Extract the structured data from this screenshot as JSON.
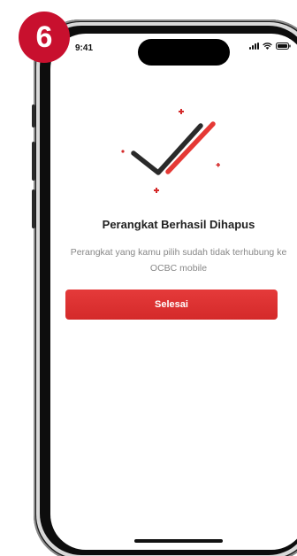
{
  "step": {
    "number": "6"
  },
  "status_bar": {
    "time": "9:41",
    "icons": [
      "signal-icon",
      "wifi-icon",
      "battery-icon"
    ]
  },
  "screen": {
    "title": "Perangkat Berhasil Dihapus",
    "description": "Perangkat yang kamu pilih sudah tidak terhubung ke OCBC mobile",
    "primary_button_label": "Selesai"
  },
  "colors": {
    "accent_red": "#d42a2a",
    "badge_red": "#c8102e",
    "check_dark": "#2a2a2a"
  }
}
